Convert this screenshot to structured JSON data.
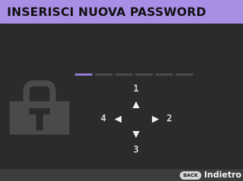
{
  "title": "INSERISCI NUOVA PASSWORD",
  "password": {
    "total_digits": 6,
    "entered_digits": 1
  },
  "directions": {
    "up": "1",
    "right": "2",
    "down": "3",
    "left": "4"
  },
  "footer": {
    "back_button": "BACK",
    "back_label": "Indietro"
  },
  "colors": {
    "title_bar": "#a98ee6",
    "background": "#2b2b2b",
    "active_slot": "#9b7fe0",
    "inactive_slot": "#4d4d4d"
  },
  "icons": {
    "lock": "lock-icon"
  }
}
